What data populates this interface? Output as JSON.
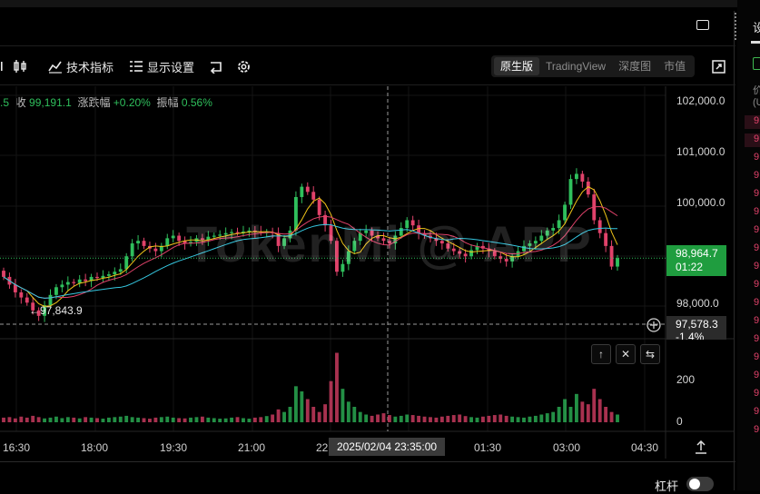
{
  "toolbar": {
    "indicators_label": "技术指标",
    "display_settings_label": "显示设置",
    "views": [
      "原生版",
      "TradingView",
      "深度图",
      "市值"
    ],
    "active_view": "原生版"
  },
  "info": {
    "partial_prev": ".5",
    "close_label": "收",
    "close_value": "99,191.1",
    "change_label": "涨跌幅",
    "change_value": "+0.20%",
    "amplitude_label": "振幅",
    "amplitude_value": "0.56%"
  },
  "right_panel": {
    "header": "设",
    "label_price": "价",
    "label_unit": "(U",
    "rows": [
      "9",
      "9",
      "9",
      "9",
      "9",
      "9",
      "9",
      "9",
      "9",
      "9",
      "9",
      "9",
      "9",
      "9",
      "9",
      "9",
      "9",
      "9"
    ]
  },
  "chart": {
    "y_labels": [
      "102,000.0",
      "101,000.0",
      "100,000.0",
      "98,000.0"
    ],
    "vol_labels": [
      "200",
      "0"
    ],
    "x_labels": [
      "16:30",
      "18:00",
      "19:30",
      "21:00",
      "22",
      "01:30",
      "03:00",
      "04:30"
    ],
    "last_price": "98,964.7",
    "countdown": "01:22",
    "cross_price": "97,578.3",
    "cross_change": "-1.4%",
    "crosshair_time": "2025/02/04 23:35:00",
    "low_label": "←97,843.9",
    "watermark": "TokenMi @ APP",
    "colors": {
      "up": "#2fbf5c",
      "down": "#e0426a",
      "ma5": "#f0c419",
      "ma10": "#e0426a",
      "ma20": "#35c7e0"
    }
  },
  "chart_data": {
    "type": "candlestick",
    "title": "",
    "xlabel": "",
    "ylabel": "",
    "x_ticks": [
      "16:30",
      "18:00",
      "19:30",
      "21:00",
      "22",
      "01:30",
      "03:00",
      "04:30"
    ],
    "ylim": [
      97400,
      102300
    ],
    "series": [
      {
        "closes": [
          98600,
          98450,
          98300,
          98200,
          98100,
          97950,
          97844,
          98050,
          98250,
          98400,
          98450,
          98500,
          98480,
          98550,
          98520,
          98600,
          98580,
          98620,
          98650,
          98700,
          98750,
          99000,
          99250,
          99300,
          99200,
          99150,
          99100,
          99200,
          99350,
          99400,
          99300,
          99250,
          99280,
          99350,
          99320,
          99380,
          99400,
          99420,
          99450,
          99470,
          99460,
          99480,
          99500,
          99480,
          99460,
          99470,
          99450,
          99200,
          99350,
          99500,
          100150,
          100350,
          100250,
          100100,
          99800,
          99600,
          99300,
          98700,
          98850,
          99100,
          99300,
          99450,
          99500,
          99400,
          99350,
          99300,
          99250,
          99400,
          99550,
          99700,
          99600,
          99450,
          99400,
          99350,
          99300,
          99250,
          99150,
          99100,
          99050,
          99000,
          99120,
          99200,
          99150,
          99100,
          99000,
          98950,
          98900,
          99000,
          99100,
          99200,
          99250,
          99300,
          99400,
          99500,
          99550,
          99700,
          100000,
          100500,
          100600,
          100450,
          100200,
          99700,
          99450,
          99200,
          98800,
          98964
        ]
      }
    ],
    "volume_ylim": [
      0,
      300
    ],
    "volumes": [
      18,
      20,
      15,
      22,
      18,
      25,
      20,
      15,
      18,
      22,
      16,
      20,
      18,
      15,
      20,
      18,
      16,
      14,
      18,
      20,
      22,
      25,
      20,
      18,
      16,
      14,
      18,
      20,
      22,
      18,
      16,
      15,
      18,
      20,
      22,
      18,
      16,
      14,
      15,
      18,
      20,
      16,
      14,
      18,
      20,
      24,
      30,
      50,
      40,
      60,
      140,
      120,
      90,
      60,
      40,
      70,
      160,
      270,
      130,
      80,
      60,
      40,
      30,
      25,
      30,
      35,
      28,
      22,
      25,
      30,
      28,
      25,
      22,
      20,
      18,
      22,
      25,
      28,
      30,
      24,
      20,
      18,
      22,
      25,
      28,
      30,
      25,
      22,
      20,
      18,
      22,
      25,
      30,
      35,
      40,
      60,
      90,
      60,
      110,
      80,
      70,
      130,
      90,
      60,
      40,
      30
    ]
  }
}
